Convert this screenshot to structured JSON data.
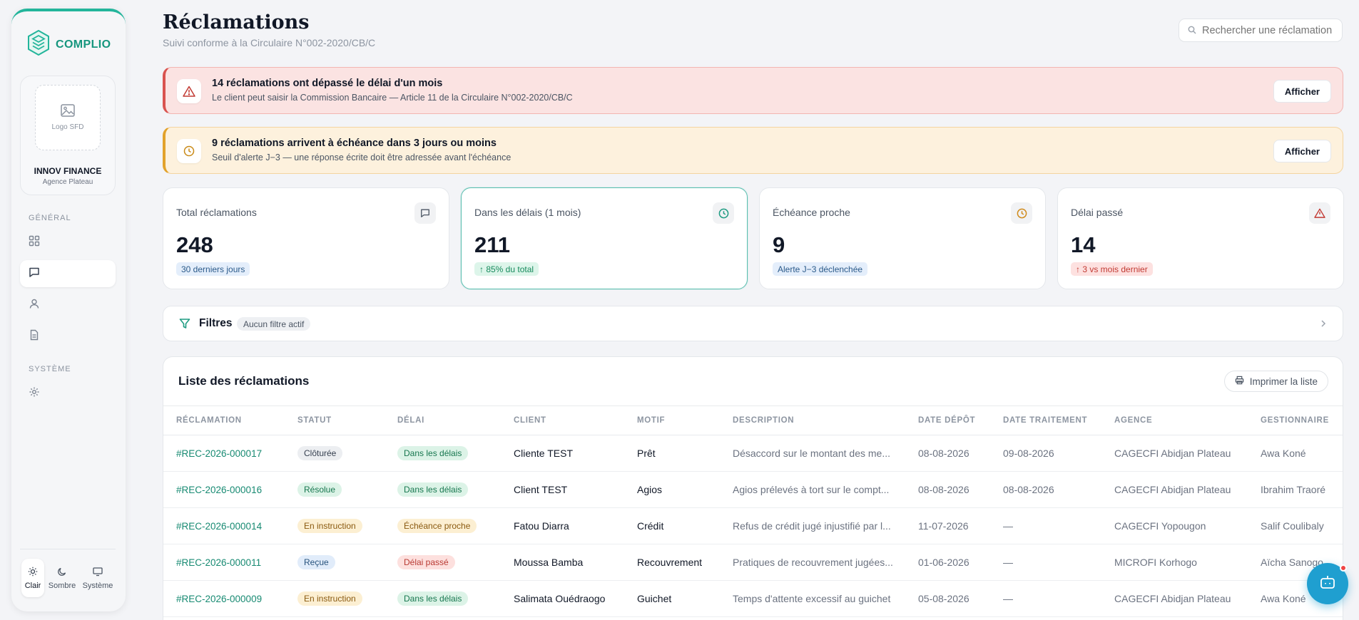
{
  "brand": {
    "name": "COMPLIO",
    "color": "#16967e"
  },
  "org": {
    "logo_placeholder": "Logo SFD",
    "name": "INNOV FINANCE",
    "agency": "Agence Plateau"
  },
  "sidebar": {
    "section_general": "GÉNÉRAL",
    "section_system": "SYSTÈME",
    "items": [
      {
        "icon": "grid-icon",
        "active": false
      },
      {
        "icon": "message-icon",
        "active": true
      },
      {
        "icon": "user-icon",
        "active": false
      },
      {
        "icon": "document-icon",
        "active": false
      },
      {
        "icon": "gear-icon",
        "active": false
      }
    ]
  },
  "theme": {
    "light": "Clair",
    "dark": "Sombre",
    "system": "Système",
    "selected": "Clair"
  },
  "header": {
    "title": "Réclamations",
    "subtitle": "Suivi conforme à la Circulaire N°002-2020/CB/C",
    "search_placeholder": "Rechercher une réclamation"
  },
  "alerts": {
    "overdue": {
      "title": "14 réclamations ont dépassé le délai d'un mois",
      "text": "Le client peut saisir la Commission Bancaire — Article 11 de la Circulaire N°002-2020/CB/C",
      "button": "Afficher"
    },
    "due_soon": {
      "title": "9 réclamations arrivent à échéance dans 3 jours ou moins",
      "text": "Seuil d'alerte J−3 — une réponse écrite doit être adressée avant l'échéance",
      "button": "Afficher"
    }
  },
  "stats": [
    {
      "label": "Total réclamations",
      "value": "248",
      "note": "30 derniers jours",
      "icon": "message-icon"
    },
    {
      "label": "Dans les délais (1 mois)",
      "value": "211",
      "note": "↑ 85% du total",
      "icon": "clock-icon"
    },
    {
      "label": "Échéance proche",
      "value": "9",
      "note": "Alerte J−3 déclenchée",
      "icon": "clock-icon"
    },
    {
      "label": "Délai passé",
      "value": "14",
      "note": "↑ 3 vs mois dernier",
      "icon": "warning-icon"
    }
  ],
  "filters": {
    "label": "Filtres",
    "badge": "Aucun filtre actif"
  },
  "list": {
    "title": "Liste des réclamations",
    "print_button": "Imprimer la liste",
    "columns": [
      "RÉCLAMATION",
      "STATUT",
      "DÉLAI",
      "CLIENT",
      "MOTIF",
      "DESCRIPTION",
      "DATE DÉPÔT",
      "DATE TRAITEMENT",
      "AGENCE",
      "GESTIONNAIRE"
    ],
    "rows": [
      {
        "ref": "#REC-2026-000017",
        "status": "Clôturée",
        "delay": "Dans les délais",
        "client": "Cliente TEST",
        "motif": "Prêt",
        "description": "Désaccord sur le montant des me...",
        "date_depot": "08-08-2026",
        "date_traitement": "09-08-2026",
        "agence": "CAGECFI Abidjan Plateau",
        "gestionnaire": "Awa Koné"
      },
      {
        "ref": "#REC-2026-000016",
        "status": "Résolue",
        "delay": "Dans les délais",
        "client": "Client TEST",
        "motif": "Agios",
        "description": "Agios prélevés à tort sur le compt...",
        "date_depot": "08-08-2026",
        "date_traitement": "08-08-2026",
        "agence": "CAGECFI Abidjan Plateau",
        "gestionnaire": "Ibrahim Traoré"
      },
      {
        "ref": "#REC-2026-000014",
        "status": "En instruction",
        "delay": "Échéance proche",
        "client": "Fatou Diarra",
        "motif": "Crédit",
        "description": "Refus de crédit jugé injustifié par l...",
        "date_depot": "11-07-2026",
        "date_traitement": "—",
        "agence": "CAGECFI Yopougon",
        "gestionnaire": "Salif Coulibaly"
      },
      {
        "ref": "#REC-2026-000011",
        "status": "Reçue",
        "delay": "Délai passé",
        "client": "Moussa Bamba",
        "motif": "Recouvrement",
        "description": "Pratiques de recouvrement jugées...",
        "date_depot": "01-06-2026",
        "date_traitement": "—",
        "agence": "MICROFI Korhogo",
        "gestionnaire": "Aïcha Sanogo"
      },
      {
        "ref": "#REC-2026-000009",
        "status": "En instruction",
        "delay": "Dans les délais",
        "client": "Salimata Ouédraogo",
        "motif": "Guichet",
        "description": "Temps d'attente excessif au guichet",
        "date_depot": "05-08-2026",
        "date_traitement": "—",
        "agence": "CAGECFI Abidjan Plateau",
        "gestionnaire": "Awa Koné"
      }
    ]
  }
}
